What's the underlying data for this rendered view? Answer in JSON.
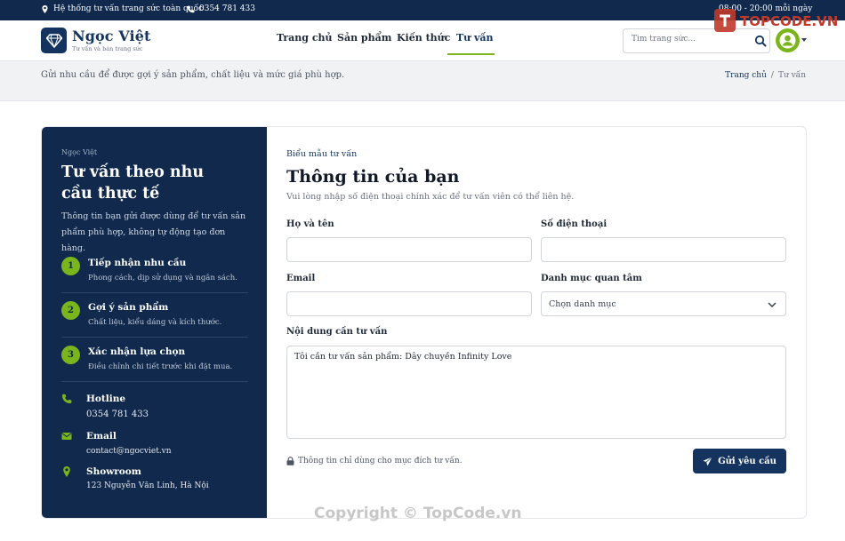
{
  "topbar": {
    "tagline": "Hệ thống tư vấn trang sức toàn quốc",
    "phone": "0354 781 433",
    "hours": "08:00 - 20:00 mỗi ngày"
  },
  "header": {
    "brand": "Ngọc Việt",
    "brand_tagline": "Tư vấn và bán trang sức",
    "nav": [
      "Trang chủ",
      "Sản phẩm",
      "Kiến thức",
      "Tư vấn"
    ],
    "active_nav": "Tư vấn",
    "search_placeholder": "Tìm trang sức..."
  },
  "page_header": {
    "subtitle": "Gửi nhu cầu để được gợi ý sản phẩm, chất liệu và mức giá phù hợp.",
    "breadcrumb": [
      "Trang chủ",
      "/",
      "Tư vấn"
    ]
  },
  "sidebar": {
    "brand": "Ngọc Việt",
    "title": "Tư vấn theo nhu cầu thực tế",
    "description": "Thông tin bạn gửi được dùng để tư vấn sản phẩm phù hợp, không tự động tạo đơn hàng.",
    "steps": [
      {
        "num": "1",
        "title": "Tiếp nhận nhu cầu",
        "desc": "Phong cách, dịp sử dụng và ngân sách."
      },
      {
        "num": "2",
        "title": "Gợi ý sản phẩm",
        "desc": "Chất liệu, kiểu dáng và kích thước."
      },
      {
        "num": "3",
        "title": "Xác nhận lựa chọn",
        "desc": "Điều chỉnh chi tiết trước khi đặt mua."
      }
    ],
    "contacts": [
      {
        "icon": "phone-icon",
        "title": "Hotline",
        "value": "0354 781 433"
      },
      {
        "icon": "envelope-icon",
        "title": "Email",
        "value": "contact@ngocviet.vn"
      },
      {
        "icon": "map-pin-icon",
        "title": "Showroom",
        "value": "123 Nguyễn Văn Linh, Hà Nội"
      }
    ]
  },
  "form": {
    "eyebrow": "Biểu mẫu tư vấn",
    "title": "Thông tin của bạn",
    "subtitle": "Vui lòng nhập số điện thoại chính xác để tư vấn viên có thể liên hệ.",
    "labels": {
      "name": "Họ và tên",
      "phone": "Số điện thoại",
      "email": "Email",
      "category": "Danh mục quan tâm",
      "message": "Nội dung cần tư vấn"
    },
    "values": {
      "name": "",
      "phone": "",
      "email": "",
      "message": "Tôi cần tư vấn sản phẩm: Dây chuyền Infinity Love"
    },
    "category_selected": "Chọn danh mục",
    "privacy_note": "Thông tin chỉ dùng cho mục đích tư vấn.",
    "submit_label": "Gửi yêu cầu"
  },
  "watermark": {
    "logo_text": "TOPCODE.VN",
    "copyright": "Copyright © TopCode.vn"
  },
  "colors": {
    "navy": "#10294d",
    "accent_green": "#7ab51d",
    "button": "#14345f"
  }
}
